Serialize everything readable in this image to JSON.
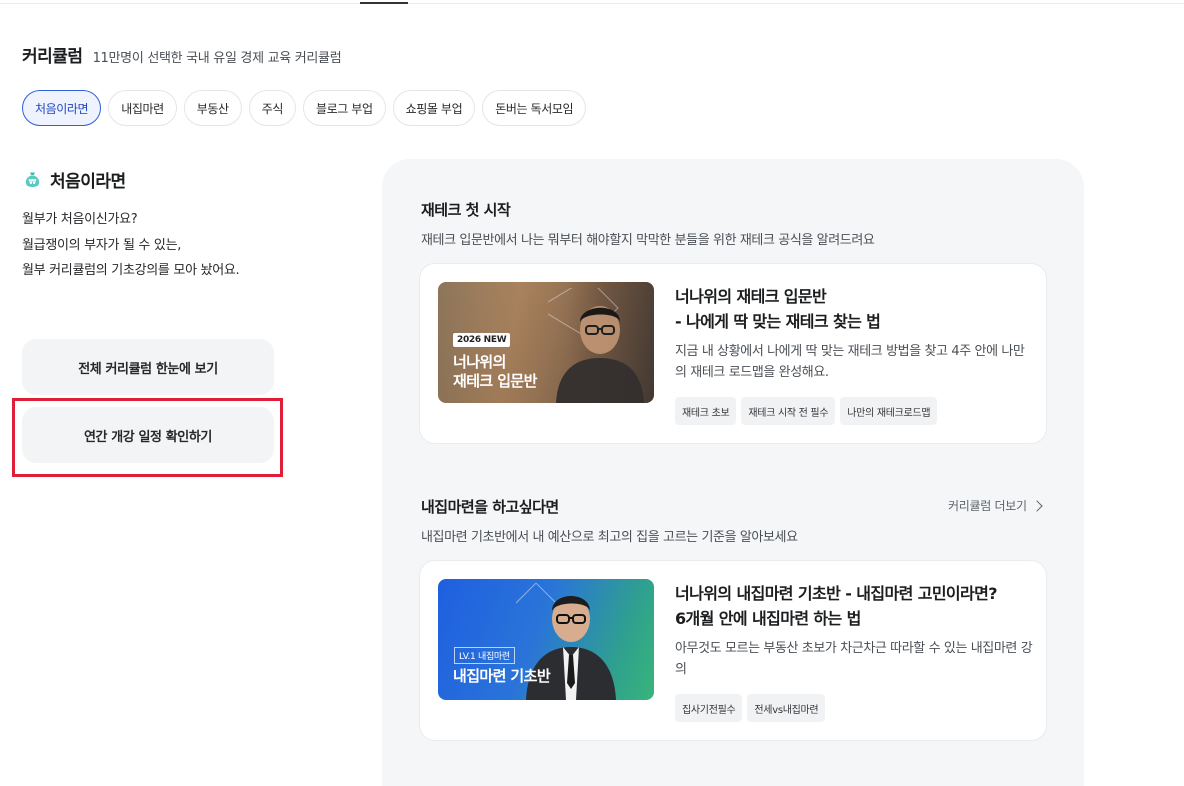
{
  "header": {
    "title": "커리큘럼",
    "subtitle": "11만명이 선택한 국내 유일 경제 교육 커리큘럼"
  },
  "chips": [
    {
      "label": "처음이라면",
      "active": true
    },
    {
      "label": "내집마련",
      "active": false
    },
    {
      "label": "부동산",
      "active": false
    },
    {
      "label": "주식",
      "active": false
    },
    {
      "label": "블로그 부업",
      "active": false
    },
    {
      "label": "쇼핑몰 부업",
      "active": false
    },
    {
      "label": "돈버는 독서모임",
      "active": false
    }
  ],
  "left": {
    "icon": "money-bag-icon",
    "title": "처음이라면",
    "desc": [
      "월부가 처음이신가요?",
      "월급쟁이의 부자가 될 수 있는,",
      "월부 커리큘럼의 기초강의를 모아 놨어요."
    ],
    "button_all": "전체 커리큘럼 한눈에 보기",
    "button_schedule": "연간 개강 일정 확인하기"
  },
  "sections": [
    {
      "title": "재테크 첫 시작",
      "subtitle": "재테크 입문반에서 나는 뭐부터 해야할지 막막한 분들을 위한 재테크 공식을 알려드려요",
      "card": {
        "thumb_badge": "2026 NEW",
        "thumb_title": [
          "너나위의",
          "재테크 입문반"
        ],
        "title": [
          "너나위의 재테크 입문반",
          "- 나에게 딱 맞는 재테크 찾는 법"
        ],
        "desc": "지금 내 상황에서 나에게 딱 맞는 재테크 방법을 찾고 4주 안에 나만의 재테크 로드맵을 완성해요.",
        "tags": [
          "재테크 초보",
          "재테크 시작 전 필수",
          "나만의 재테크로드맵"
        ]
      }
    },
    {
      "title": "내집마련을 하고싶다면",
      "subtitle": "내집마련 기초반에서 내 예산으로 최고의 집을 고르는 기준을 알아보세요",
      "more": "커리큘럼 더보기",
      "card": {
        "thumb_badge": "LV.1  내집마련",
        "thumb_title": [
          "내집마련 기초반"
        ],
        "title": [
          "너나위의 내집마련 기초반 - 내집마련 고민이라면?",
          "6개월 안에 내집마련 하는 법"
        ],
        "desc": "아무것도 모르는 부동산 초보가 차근차근 따라할 수 있는 내집마련 강의",
        "tags": [
          "집사기전필수",
          "전세vs내집마련"
        ]
      }
    }
  ],
  "colors": {
    "accent": "#2f5fd6",
    "highlight": "#e01e37",
    "panel": "#f5f6f8"
  }
}
